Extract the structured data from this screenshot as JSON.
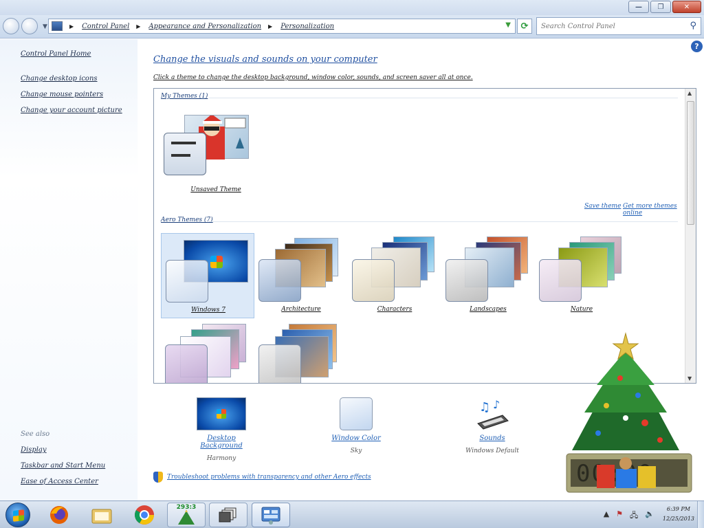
{
  "window": {
    "minimize": "—",
    "restore": "❐",
    "close": "✕"
  },
  "navbar": {
    "breadcrumbs": [
      "Control Panel",
      "Appearance and Personalization",
      "Personalization"
    ],
    "search_placeholder": "Search Control Panel",
    "refresh_icon": "⟳",
    "search_icon": "⚲"
  },
  "sidebar": {
    "home": "Control Panel Home",
    "tasks": [
      "Change desktop icons",
      "Change mouse pointers",
      "Change your account picture"
    ],
    "see_also_title": "See also",
    "see_also": [
      "Display",
      "Taskbar and Start Menu",
      "Ease of Access Center"
    ]
  },
  "main": {
    "help": "?",
    "heading": "Change the visuals and sounds on your computer",
    "subheading": "Click a theme to change the desktop background, window color, sounds, and screen saver all at once.",
    "my_themes": {
      "title": "My Themes (1)",
      "items": [
        {
          "label": "Unsaved Theme"
        }
      ]
    },
    "save_theme": "Save theme",
    "get_more": "Get more themes online",
    "aero_themes": {
      "title": "Aero Themes (7)",
      "items": [
        {
          "label": "Windows 7"
        },
        {
          "label": "Architecture"
        },
        {
          "label": "Characters"
        },
        {
          "label": "Landscapes"
        },
        {
          "label": "Nature"
        }
      ]
    },
    "bottom": [
      {
        "label": "Desktop Background",
        "sub": "Harmony"
      },
      {
        "label": "Window Color",
        "sub": "Sky"
      },
      {
        "label": "Sounds",
        "sub": "Windows Default"
      }
    ],
    "troubleshoot": "Troubleshoot problems with transparency and other Aero effects"
  },
  "taskbar": {
    "gadget_counter": "293:3",
    "clock_time": "6:39 PM",
    "clock_date": "12/25/2013"
  },
  "colors": {
    "link": "#1f5fb5",
    "heading": "#1f4fa0",
    "selection": "#dce9f8"
  }
}
